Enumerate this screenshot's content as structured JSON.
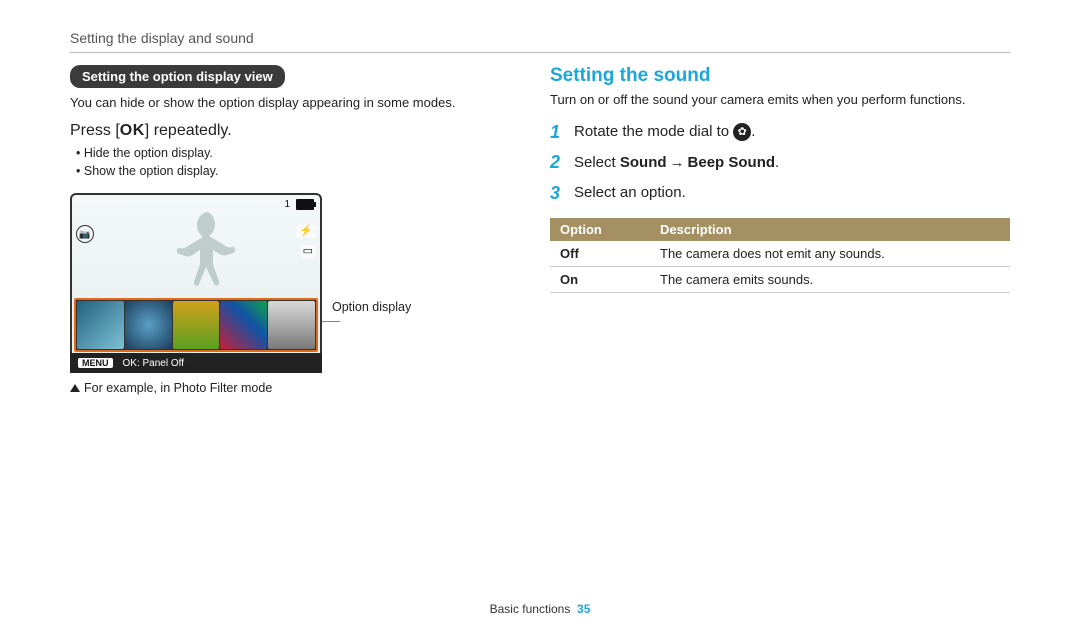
{
  "breadcrumb": "Setting the display and sound",
  "left": {
    "pill": "Setting the option display view",
    "intro": "You can hide or show the option display appearing in some modes.",
    "press_pre": "Press [",
    "press_ok": "OK",
    "press_post": "] repeatedly.",
    "bullets": [
      "Hide the option display.",
      "Show the option display."
    ],
    "hud_count": "1",
    "menu_label": "MENU",
    "panel_off": "OK: Panel Off",
    "callout": "Option display",
    "legend": "For example, in Photo Filter mode"
  },
  "right": {
    "heading": "Setting the sound",
    "intro": "Turn on or off the sound your camera emits when you perform functions.",
    "steps": [
      {
        "n": "1",
        "text_pre": "Rotate the mode dial to ",
        "icon": "gear",
        "text_post": "."
      },
      {
        "n": "2",
        "text_pre": "Select ",
        "bold1": "Sound",
        "arrow": "→",
        "bold2": "Beep Sound",
        "text_post": "."
      },
      {
        "n": "3",
        "text_pre": "Select an option."
      }
    ],
    "table": {
      "h1": "Option",
      "h2": "Description",
      "rows": [
        {
          "opt": "Off",
          "desc": "The camera does not emit any sounds."
        },
        {
          "opt": "On",
          "desc": "The camera emits sounds."
        }
      ]
    }
  },
  "footer": {
    "section": "Basic functions",
    "page": "35"
  }
}
